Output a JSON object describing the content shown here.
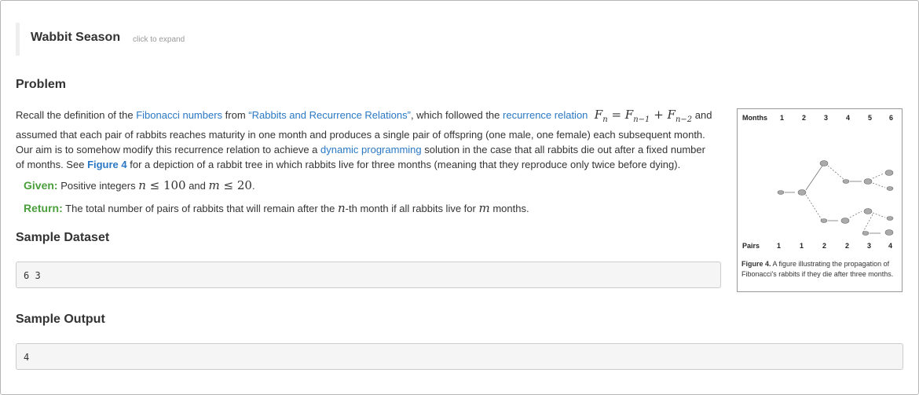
{
  "header": {
    "title": "Wabbit Season",
    "expand_hint": "click to expand"
  },
  "problem": {
    "heading": "Problem",
    "p1": {
      "t1": "Recall the definition of the ",
      "link_fib": "Fibonacci numbers",
      "t2": " from ",
      "link_rabbits": "“Rabbits and Recurrence Relations”",
      "t3": ", which followed the ",
      "link_recurrence": "recurrence relation",
      "t4": " and",
      "line2": "assumed that each pair of rabbits reaches maturity in one month and produces a single pair of offspring (one male, one female) each subsequent month."
    },
    "p2": {
      "t1": "Our aim is to somehow modify this recurrence relation to achieve a ",
      "link_dp": "dynamic programming",
      "t2": " solution in the case that all rabbits die out after a fixed number",
      "t3": "of months. See ",
      "link_figure": "Figure 4",
      "t4": " for a depiction of a rabbit tree in which rabbits live for three months (meaning that they reproduce only twice before dying)."
    },
    "given": {
      "label": "Given:",
      "t1": " Positive integers ",
      "t2": " and ",
      "t3": "."
    },
    "return": {
      "label": "Return:",
      "t1": " The total number of pairs of rabbits that will remain after the ",
      "t2": "-th month if all rabbits live for ",
      "t3": " months."
    }
  },
  "sample_dataset": {
    "heading": "Sample Dataset",
    "value": "6 3"
  },
  "sample_output": {
    "heading": "Sample Output",
    "value": "4"
  },
  "figure": {
    "months_label": "Months",
    "months": [
      "1",
      "2",
      "3",
      "4",
      "5",
      "6"
    ],
    "pairs_label": "Pairs",
    "pairs": [
      "1",
      "1",
      "2",
      "2",
      "3",
      "4"
    ],
    "caption_label": "Figure 4.",
    "caption_text": " A figure illustrating the propagation of Fibonacci's rabbits if they die after three months."
  },
  "colors": {
    "link": "#2a78c4",
    "given_return": "#4a9e3b"
  }
}
